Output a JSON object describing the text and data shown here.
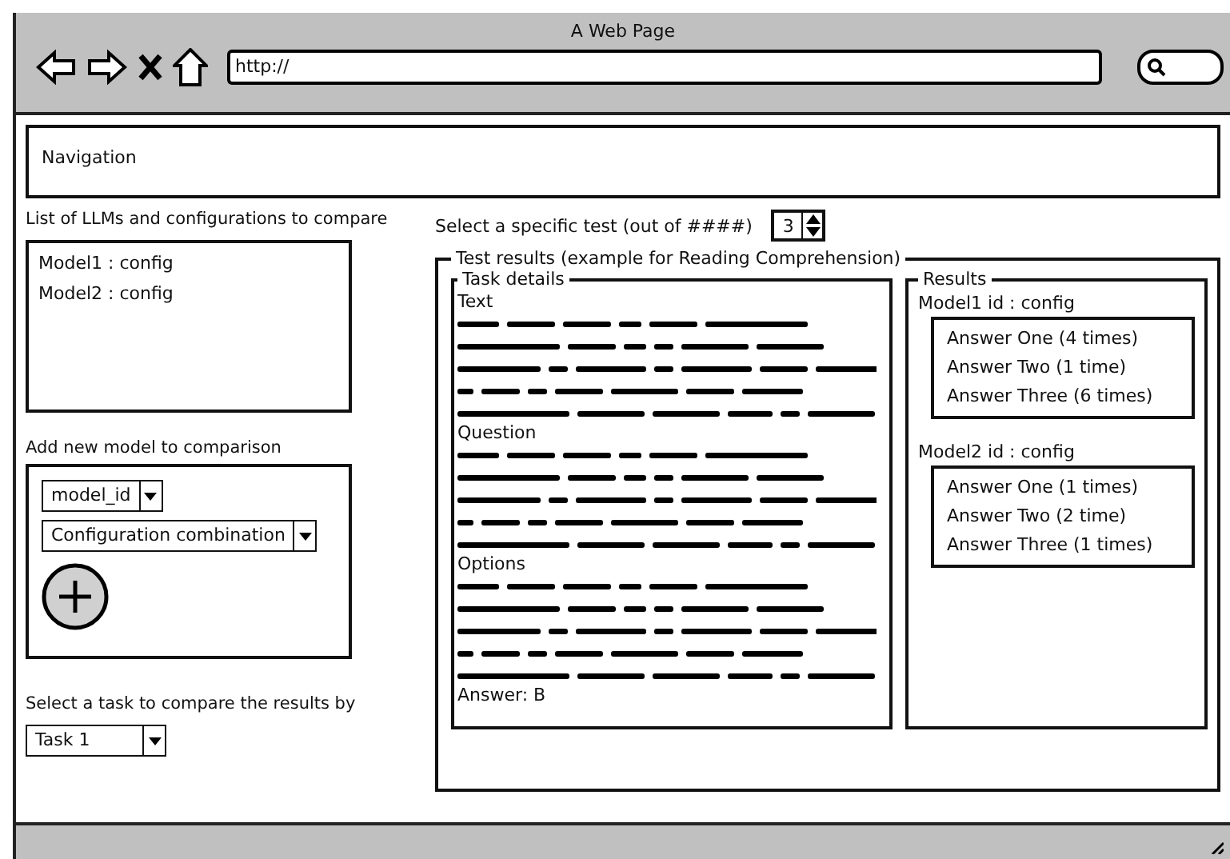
{
  "window": {
    "title": "A Web Page",
    "url": "http://"
  },
  "navigation": {
    "label": "Navigation"
  },
  "models_list": {
    "label": "List of LLMs and configurations to compare",
    "items": [
      "Model1 : config",
      "Model2 : config"
    ]
  },
  "add_model": {
    "label": "Add new model to comparison",
    "model_select": "model_id",
    "config_select": "Configuration combination"
  },
  "task_select": {
    "label": "Select a task to compare the results by",
    "value": "Task 1"
  },
  "test_select": {
    "label": "Select a specific test (out of ####)",
    "value": "3"
  },
  "test_results": {
    "title": "Test results (example for Reading Comprehension)",
    "task_details": {
      "title": "Task details",
      "sections": [
        {
          "heading": "Text"
        },
        {
          "heading": "Question"
        },
        {
          "heading": "Options"
        }
      ],
      "answer": "Answer: B"
    },
    "results": {
      "title": "Results",
      "models": [
        {
          "name": "Model1 id : config",
          "answers": [
            "Answer One (4 times)",
            "Answer Two (1 time)",
            "Answer Three (6 times)"
          ]
        },
        {
          "name": "Model2 id : config",
          "answers": [
            "Answer One (1 times)",
            "Answer Two (2 time)",
            "Answer Three (1 times)"
          ]
        }
      ]
    }
  }
}
